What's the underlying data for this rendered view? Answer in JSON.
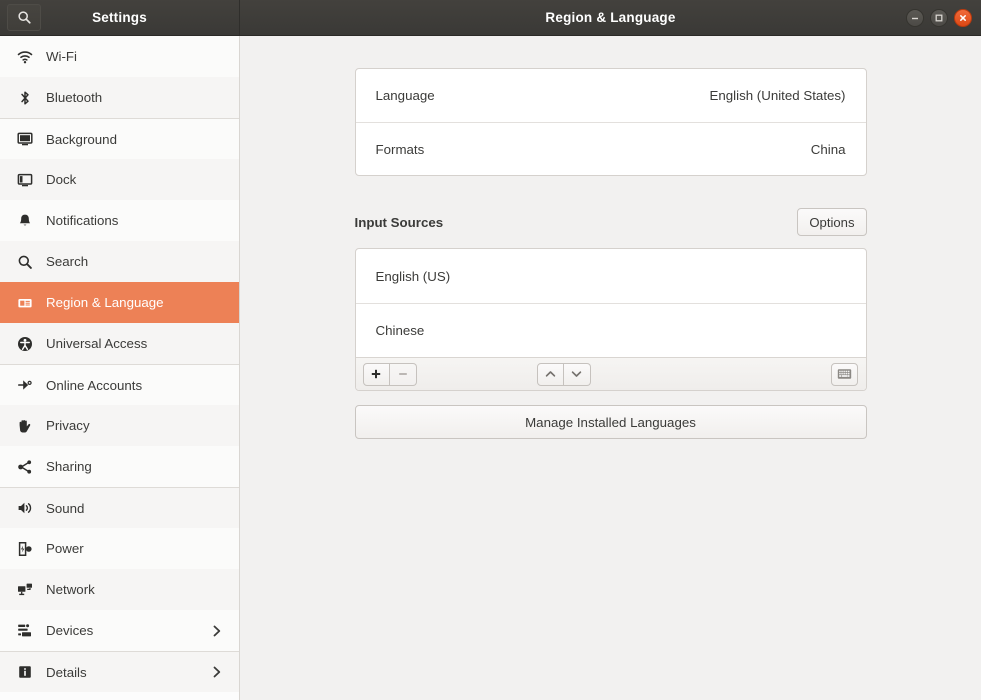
{
  "titlebar": {
    "sidebar_title": "Settings",
    "window_title": "Region & Language",
    "search_icon": "search-icon",
    "minimize_icon": "minimize-icon",
    "maximize_icon": "maximize-icon",
    "close_icon": "close-icon"
  },
  "sidebar": {
    "items": [
      {
        "label": "Wi-Fi",
        "icon": "wifi-icon",
        "chevron": false,
        "active": false,
        "separator": false
      },
      {
        "label": "Bluetooth",
        "icon": "bluetooth-icon",
        "chevron": false,
        "active": false,
        "separator": false
      },
      {
        "label": "Background",
        "icon": "background-icon",
        "chevron": false,
        "active": false,
        "separator": true
      },
      {
        "label": "Dock",
        "icon": "dock-icon",
        "chevron": false,
        "active": false,
        "separator": false
      },
      {
        "label": "Notifications",
        "icon": "notifications-icon",
        "chevron": false,
        "active": false,
        "separator": false
      },
      {
        "label": "Search",
        "icon": "search-icon",
        "chevron": false,
        "active": false,
        "separator": false
      },
      {
        "label": "Region & Language",
        "icon": "region-language-icon",
        "chevron": false,
        "active": true,
        "separator": false
      },
      {
        "label": "Universal Access",
        "icon": "universal-access-icon",
        "chevron": false,
        "active": false,
        "separator": false
      },
      {
        "label": "Online Accounts",
        "icon": "online-accounts-icon",
        "chevron": false,
        "active": false,
        "separator": true
      },
      {
        "label": "Privacy",
        "icon": "privacy-icon",
        "chevron": false,
        "active": false,
        "separator": false
      },
      {
        "label": "Sharing",
        "icon": "sharing-icon",
        "chevron": false,
        "active": false,
        "separator": false
      },
      {
        "label": "Sound",
        "icon": "sound-icon",
        "chevron": false,
        "active": false,
        "separator": true
      },
      {
        "label": "Power",
        "icon": "power-icon",
        "chevron": false,
        "active": false,
        "separator": false
      },
      {
        "label": "Network",
        "icon": "network-icon",
        "chevron": false,
        "active": false,
        "separator": false
      },
      {
        "label": "Devices",
        "icon": "devices-icon",
        "chevron": true,
        "active": false,
        "separator": false
      },
      {
        "label": "Details",
        "icon": "details-icon",
        "chevron": true,
        "active": false,
        "separator": true
      }
    ]
  },
  "main": {
    "language_card": {
      "rows": [
        {
          "label": "Language",
          "value": "English (United States)"
        },
        {
          "label": "Formats",
          "value": "China"
        }
      ]
    },
    "input_sources": {
      "title": "Input Sources",
      "options_label": "Options",
      "sources": [
        {
          "label": "English (US)"
        },
        {
          "label": "Chinese"
        }
      ],
      "toolbar": {
        "add_icon": "plus-icon",
        "remove_icon": "minus-icon",
        "move_up_icon": "chevron-up-icon",
        "move_down_icon": "chevron-down-icon",
        "preview_icon": "keyboard-icon"
      }
    },
    "manage_languages_label": "Manage Installed Languages"
  },
  "colors": {
    "accent": "#ed8156",
    "titlebar": "#3e3c38",
    "close_button": "#dd4814",
    "content_bg": "#f2f1f0"
  }
}
